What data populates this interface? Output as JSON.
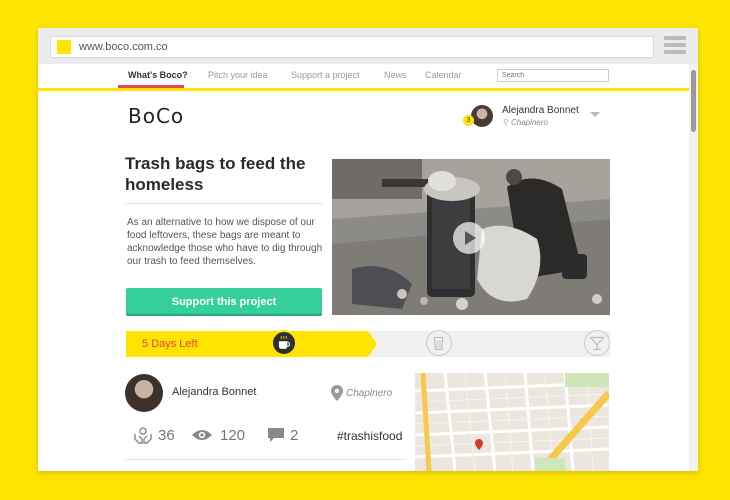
{
  "browser": {
    "url": "www.boco.com.co",
    "favicon_text": "BoCo"
  },
  "nav": {
    "items": [
      {
        "label": "What's Boco?",
        "active": true
      },
      {
        "label": "Pitch your idea",
        "active": false
      },
      {
        "label": "Support a project",
        "active": false
      },
      {
        "label": "News",
        "active": false
      },
      {
        "label": "Calendar",
        "active": false
      }
    ],
    "search_placeholder": "Search"
  },
  "header": {
    "logo": "BoCo",
    "user": {
      "name": "Alejandra Bonnet",
      "location": "Chapinero",
      "notifications": "3"
    }
  },
  "project": {
    "title": "Trash bags to feed the homeless",
    "description": "As an alternative to how we dispose of our food leftovers, these bags are meant to acknowledge those who have to dig through our trash to feed themselves.",
    "support_label": "Support this project",
    "progress": {
      "days_left": "5 Days Left",
      "fraction": 0.5,
      "milestones": [
        "coffee-cup-icon",
        "beer-glass-icon",
        "cocktail-glass-icon"
      ]
    },
    "author": {
      "name": "Alejandra Bonnet",
      "location": "Chapinero"
    },
    "stats": {
      "supporters": "36",
      "views": "120",
      "comments": "2"
    },
    "hashtag": "#trashisfood"
  },
  "colors": {
    "background": "#FFE400",
    "accent_green": "#35cf9b",
    "accent_red": "#e5484d",
    "dark": "#2c3033"
  }
}
